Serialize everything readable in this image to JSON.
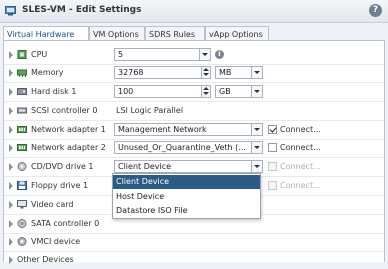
{
  "window": {
    "title": "SLES-VM - Edit Settings",
    "help_label": "?"
  },
  "tabs": [
    {
      "label": "Virtual Hardware",
      "active": true
    },
    {
      "label": "VM Options",
      "active": false
    },
    {
      "label": "SDRS Rules",
      "active": false
    },
    {
      "label": "vApp Options",
      "active": false
    }
  ],
  "devices": {
    "cpu": {
      "label": "CPU",
      "value": "5",
      "icon": "cpu-icon"
    },
    "memory": {
      "label": "Memory",
      "value": "32768",
      "unit": "MB",
      "icon": "memory-icon"
    },
    "harddisk": {
      "label": "Hard disk 1",
      "value": "100",
      "unit": "GB",
      "icon": "disk-icon"
    },
    "scsi": {
      "label": "SCSI controller 0",
      "value": "LSI Logic Parallel",
      "icon": "scsi-icon"
    },
    "net1": {
      "label": "Network adapter 1",
      "value": "Management Network",
      "connect_label": "Connect...",
      "connected": true,
      "icon": "network-icon"
    },
    "net2": {
      "label": "Network adapter 2",
      "value": "Unused_Or_Quarantine_Veth (...",
      "connect_label": "Connect...",
      "connected": false,
      "icon": "network-icon"
    },
    "cdrom": {
      "label": "CD/DVD drive 1",
      "value": "Client Device",
      "connect_label": "Connect...",
      "icon": "cdrom-icon"
    },
    "floppy": {
      "label": "Floppy drive 1",
      "connect_label": "Connect...",
      "icon": "floppy-icon"
    },
    "video": {
      "label": "Video card",
      "icon": "video-icon"
    },
    "sata": {
      "label": "SATA controller 0",
      "icon": "sata-icon"
    },
    "vmci": {
      "label": "VMCI device",
      "icon": "vmci-icon"
    },
    "other": {
      "label": "Other Devices"
    }
  },
  "cdrom_menu": {
    "options": [
      "Client Device",
      "Host Device",
      "Datastore ISO File"
    ],
    "selected": "Client Device"
  },
  "colors": {
    "selection": "#2b5b87",
    "tab_active_text": "#1a4f8a"
  }
}
